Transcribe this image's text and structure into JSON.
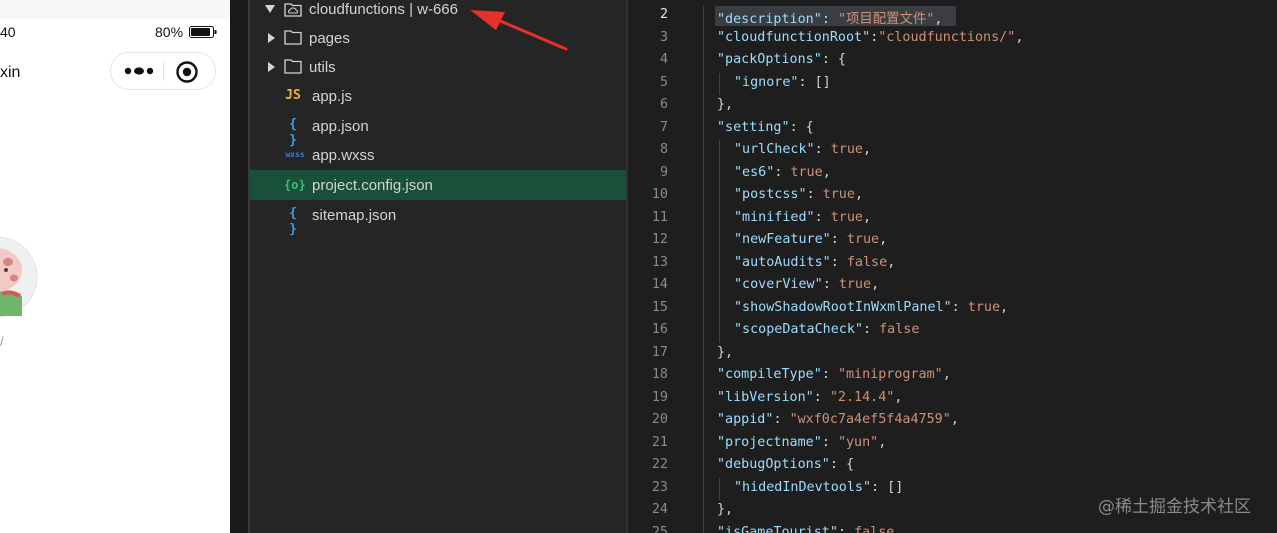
{
  "simulator": {
    "status_time": "40",
    "battery_percent": "80%",
    "nav_title": "xin",
    "avatar_caption": "/"
  },
  "explorer": {
    "items": [
      {
        "label": "cloudfunctions | w-666",
        "icon": "cloud-folder-icon",
        "expanded": true
      },
      {
        "label": "pages",
        "icon": "folder-icon",
        "expanded": false
      },
      {
        "label": "utils",
        "icon": "folder-icon",
        "expanded": false
      },
      {
        "label": "app.js",
        "icon": "js-file-icon",
        "icon_text": "JS",
        "icon_color": "#e8b33a"
      },
      {
        "label": "app.json",
        "icon": "json-file-icon",
        "icon_text": "{ }",
        "icon_color": "#3c9ee6"
      },
      {
        "label": "app.wxss",
        "icon": "wxss-file-icon",
        "icon_text": "wxss",
        "icon_color": "#3c7bd9"
      },
      {
        "label": "project.config.json",
        "icon": "config-json-file-icon",
        "icon_text": "{o}",
        "icon_color": "#3dbd7d",
        "selected": true
      },
      {
        "label": "sitemap.json",
        "icon": "json-file-icon",
        "icon_text": "{ }",
        "icon_color": "#3c9ee6"
      }
    ]
  },
  "editor": {
    "current_line": "2",
    "lines": [
      {
        "n": "2",
        "tokens": [
          [
            "key",
            "\"description\""
          ],
          [
            "punct",
            ": "
          ],
          [
            "str",
            "\"项目配置文件\""
          ],
          [
            "punct",
            ","
          ]
        ]
      },
      {
        "n": "3",
        "tokens": [
          [
            "key",
            "\"cloudfunctionRoot\""
          ],
          [
            "punct",
            ":"
          ],
          [
            "str",
            "\"cloudfunctions/\""
          ],
          [
            "punct",
            ","
          ]
        ]
      },
      {
        "n": "4",
        "tokens": [
          [
            "key",
            "\"packOptions\""
          ],
          [
            "punct",
            ": {"
          ]
        ]
      },
      {
        "n": "5",
        "tokens": [
          [
            "key",
            "\"ignore\""
          ],
          [
            "punct",
            ": []"
          ]
        ]
      },
      {
        "n": "6",
        "tokens": [
          [
            "punct",
            "},"
          ]
        ]
      },
      {
        "n": "7",
        "tokens": [
          [
            "key",
            "\"setting\""
          ],
          [
            "punct",
            ": {"
          ]
        ]
      },
      {
        "n": "8",
        "tokens": [
          [
            "key",
            "\"urlCheck\""
          ],
          [
            "punct",
            ": "
          ],
          [
            "kw",
            "true"
          ],
          [
            "punct",
            ","
          ]
        ]
      },
      {
        "n": "9",
        "tokens": [
          [
            "key",
            "\"es6\""
          ],
          [
            "punct",
            ": "
          ],
          [
            "kw",
            "true"
          ],
          [
            "punct",
            ","
          ]
        ]
      },
      {
        "n": "10",
        "tokens": [
          [
            "key",
            "\"postcss\""
          ],
          [
            "punct",
            ": "
          ],
          [
            "kw",
            "true"
          ],
          [
            "punct",
            ","
          ]
        ]
      },
      {
        "n": "11",
        "tokens": [
          [
            "key",
            "\"minified\""
          ],
          [
            "punct",
            ": "
          ],
          [
            "kw",
            "true"
          ],
          [
            "punct",
            ","
          ]
        ]
      },
      {
        "n": "12",
        "tokens": [
          [
            "key",
            "\"newFeature\""
          ],
          [
            "punct",
            ": "
          ],
          [
            "kw",
            "true"
          ],
          [
            "punct",
            ","
          ]
        ]
      },
      {
        "n": "13",
        "tokens": [
          [
            "key",
            "\"autoAudits\""
          ],
          [
            "punct",
            ": "
          ],
          [
            "kw",
            "false"
          ],
          [
            "punct",
            ","
          ]
        ]
      },
      {
        "n": "14",
        "tokens": [
          [
            "key",
            "\"coverView\""
          ],
          [
            "punct",
            ": "
          ],
          [
            "kw",
            "true"
          ],
          [
            "punct",
            ","
          ]
        ]
      },
      {
        "n": "15",
        "tokens": [
          [
            "key",
            "\"showShadowRootInWxmlPanel\""
          ],
          [
            "punct",
            ": "
          ],
          [
            "kw",
            "true"
          ],
          [
            "punct",
            ","
          ]
        ]
      },
      {
        "n": "16",
        "tokens": [
          [
            "key",
            "\"scopeDataCheck\""
          ],
          [
            "punct",
            ": "
          ],
          [
            "kw",
            "false"
          ]
        ]
      },
      {
        "n": "17",
        "tokens": [
          [
            "punct",
            "},"
          ]
        ]
      },
      {
        "n": "18",
        "tokens": [
          [
            "key",
            "\"compileType\""
          ],
          [
            "punct",
            ": "
          ],
          [
            "str",
            "\"miniprogram\""
          ],
          [
            "punct",
            ","
          ]
        ]
      },
      {
        "n": "19",
        "tokens": [
          [
            "key",
            "\"libVersion\""
          ],
          [
            "punct",
            ": "
          ],
          [
            "str",
            "\"2.14.4\""
          ],
          [
            "punct",
            ","
          ]
        ]
      },
      {
        "n": "20",
        "tokens": [
          [
            "key",
            "\"appid\""
          ],
          [
            "punct",
            ": "
          ],
          [
            "str",
            "\"wxf0c7a4ef5f4a4759\""
          ],
          [
            "punct",
            ","
          ]
        ]
      },
      {
        "n": "21",
        "tokens": [
          [
            "key",
            "\"projectname\""
          ],
          [
            "punct",
            ": "
          ],
          [
            "str",
            "\"yun\""
          ],
          [
            "punct",
            ","
          ]
        ]
      },
      {
        "n": "22",
        "tokens": [
          [
            "key",
            "\"debugOptions\""
          ],
          [
            "punct",
            ": {"
          ]
        ]
      },
      {
        "n": "23",
        "tokens": [
          [
            "key",
            "\"hidedInDevtools\""
          ],
          [
            "punct",
            ": []"
          ]
        ]
      },
      {
        "n": "24",
        "tokens": [
          [
            "punct",
            "},"
          ]
        ]
      },
      {
        "n": "25",
        "tokens": [
          [
            "key",
            "\"isGameTourist\""
          ],
          [
            "punct",
            ": "
          ],
          [
            "kw",
            "false"
          ]
        ]
      }
    ]
  },
  "watermark": "@稀土掘金技术社区",
  "colors": {
    "annotation_arrow": "#e8302a",
    "selected_row": "#18503a"
  }
}
